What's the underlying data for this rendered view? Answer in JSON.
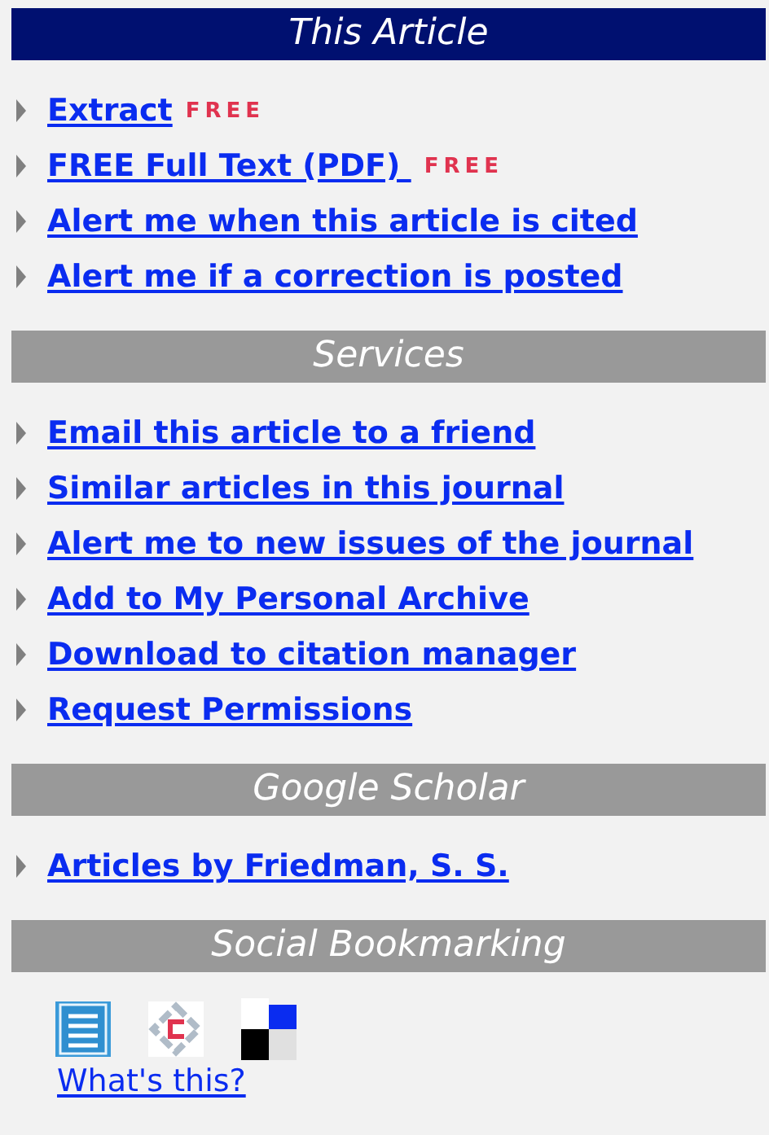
{
  "sections": [
    {
      "title": "This Article",
      "highlighted": true,
      "kind": "links",
      "links": [
        {
          "label": "Extract",
          "badge": "FREE"
        },
        {
          "label": "FREE Full Text (PDF) ",
          "badge": "FREE"
        },
        {
          "label": "Alert me when this article is cited"
        },
        {
          "label": "Alert me if a correction is posted"
        }
      ]
    },
    {
      "title": "Services",
      "highlighted": false,
      "kind": "links",
      "links": [
        {
          "label": "Email this article to a friend"
        },
        {
          "label": "Similar articles in this journal"
        },
        {
          "label": "Alert me to new issues of the journal"
        },
        {
          "label": "Add to My Personal Archive"
        },
        {
          "label": "Download to citation manager"
        },
        {
          "label": "Request Permissions"
        }
      ]
    },
    {
      "title": "Google Scholar",
      "highlighted": false,
      "kind": "links",
      "links": [
        {
          "label": "Articles by Friedman, S. S."
        }
      ]
    },
    {
      "title": "Social Bookmarking",
      "highlighted": false,
      "kind": "bookmarks",
      "link": "What's this?"
    }
  ]
}
